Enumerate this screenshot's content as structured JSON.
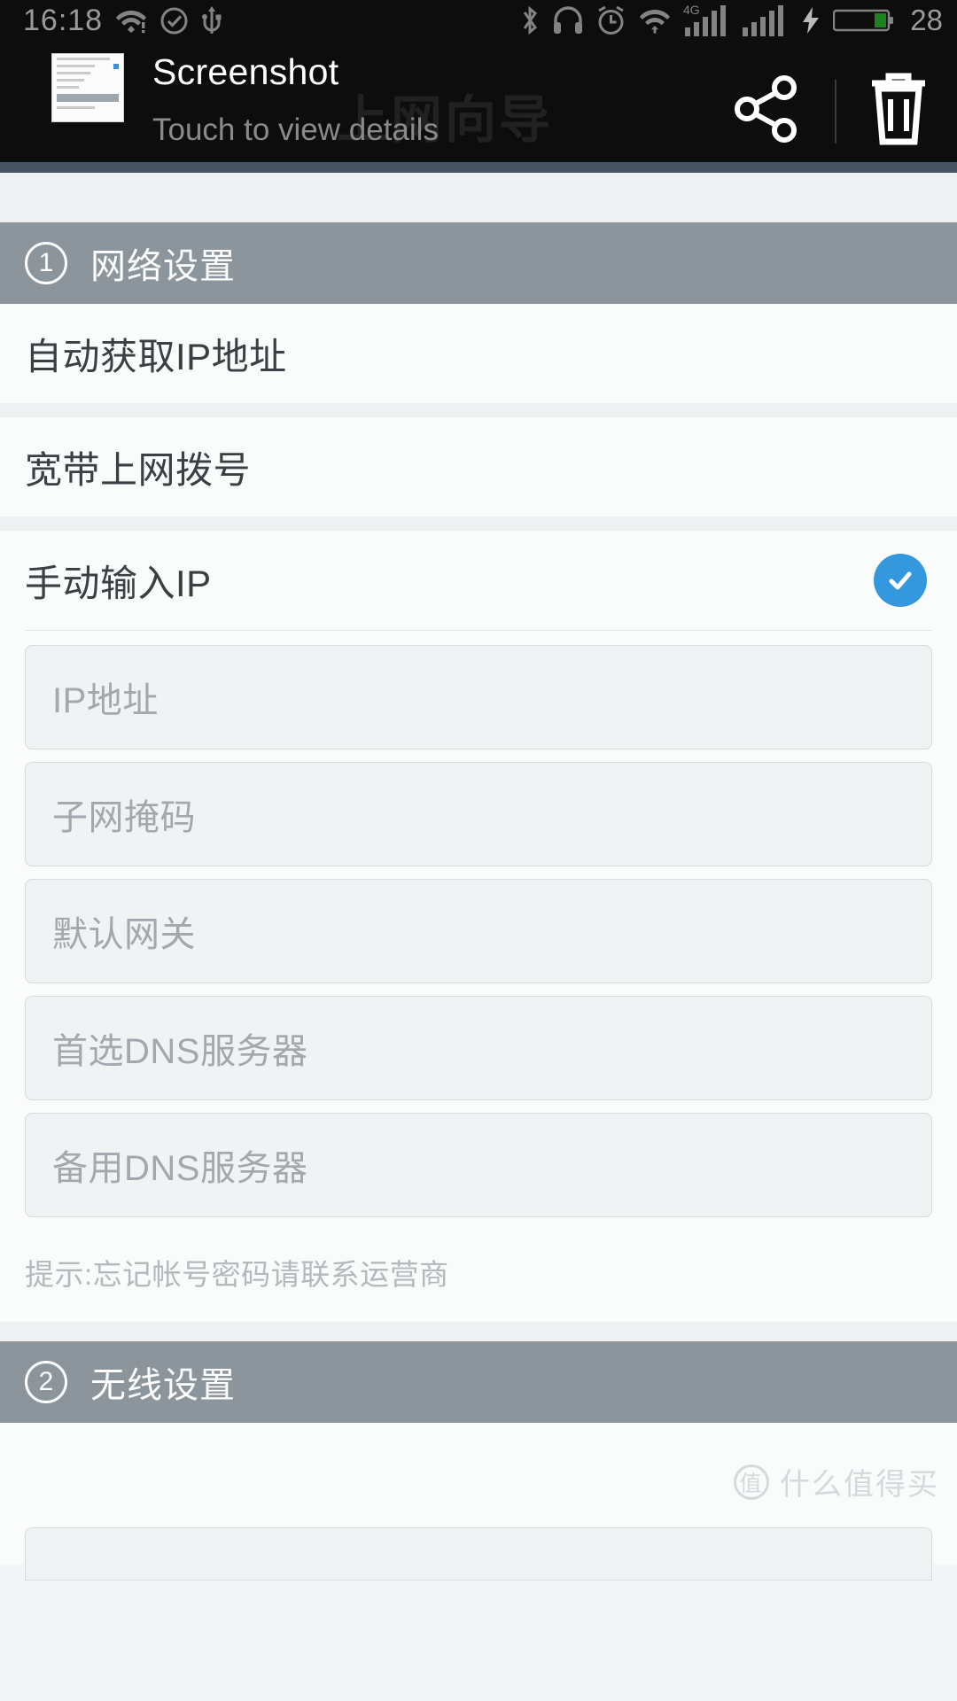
{
  "status_bar": {
    "time": "16:18",
    "battery_percent": "28",
    "left_icons": [
      "wifi-alert-icon",
      "check-circle-icon",
      "usb-icon"
    ],
    "right_icons": [
      "bluetooth-icon",
      "headset-icon",
      "alarm-icon",
      "wifi-upload-icon",
      "signal-4g-icon",
      "signal-bars-icon",
      "charging-bolt-icon",
      "battery-icon"
    ],
    "network_label": "4G"
  },
  "notification": {
    "title": "Screenshot",
    "subtitle": "Touch to view details",
    "share_icon": "share-icon",
    "delete_icon": "trash-icon",
    "thumbnail_icon": "screenshot-thumbnail"
  },
  "watermarks": {
    "shade": "上网向导",
    "footer": "什么值得买",
    "footer_badge": "值"
  },
  "sections": [
    {
      "number": "1",
      "title": "网络设置",
      "options": [
        {
          "label": "自动获取IP地址",
          "selected": false
        },
        {
          "label": "宽带上网拨号",
          "selected": false
        },
        {
          "label": "手动输入IP",
          "selected": true
        }
      ],
      "fields": [
        {
          "placeholder": "IP地址",
          "value": ""
        },
        {
          "placeholder": "子网掩码",
          "value": ""
        },
        {
          "placeholder": "默认网关",
          "value": ""
        },
        {
          "placeholder": "首选DNS服务器",
          "value": ""
        },
        {
          "placeholder": "备用DNS服务器",
          "value": ""
        }
      ],
      "hint": "提示:忘记帐号密码请联系运营商"
    },
    {
      "number": "2",
      "title": "无线设置"
    }
  ],
  "colors": {
    "accent": "#3398dd",
    "section_header": "#8b959b",
    "shade_background": "#0d0d0d",
    "page_background": "#eef0f2",
    "row_background": "#fafbfb",
    "field_background": "#f0f2f4"
  }
}
